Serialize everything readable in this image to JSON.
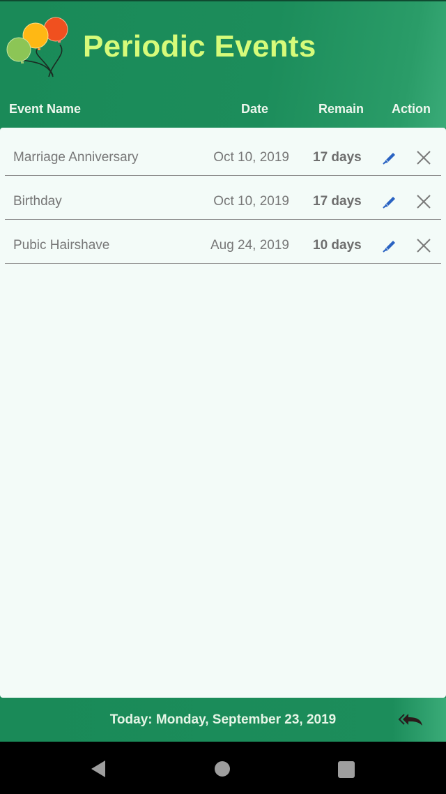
{
  "app": {
    "title": "Periodic Events",
    "logo_icon": "balloons-icon"
  },
  "columns": {
    "name": "Event Name",
    "date": "Date",
    "remain": "Remain",
    "action": "Action"
  },
  "events": [
    {
      "name": "Marriage Anniversary",
      "date": "Oct 10, 2019",
      "remain": "17 days"
    },
    {
      "name": "Birthday",
      "date": "Oct 10, 2019",
      "remain": "17 days"
    },
    {
      "name": "Pubic Hairshave",
      "date": "Aug 24, 2019",
      "remain": "10 days"
    }
  ],
  "actions": {
    "edit_icon": "pen-icon",
    "delete_icon": "close-icon"
  },
  "footer": {
    "today": "Today: Monday, September 23, 2019",
    "back_icon": "double-back-arrow-icon"
  },
  "colors": {
    "header_green": "#1a8a58",
    "title_yellow": "#d6fb7a",
    "panel_bg": "#f3fbf8",
    "edit_blue": "#2a63c2"
  }
}
